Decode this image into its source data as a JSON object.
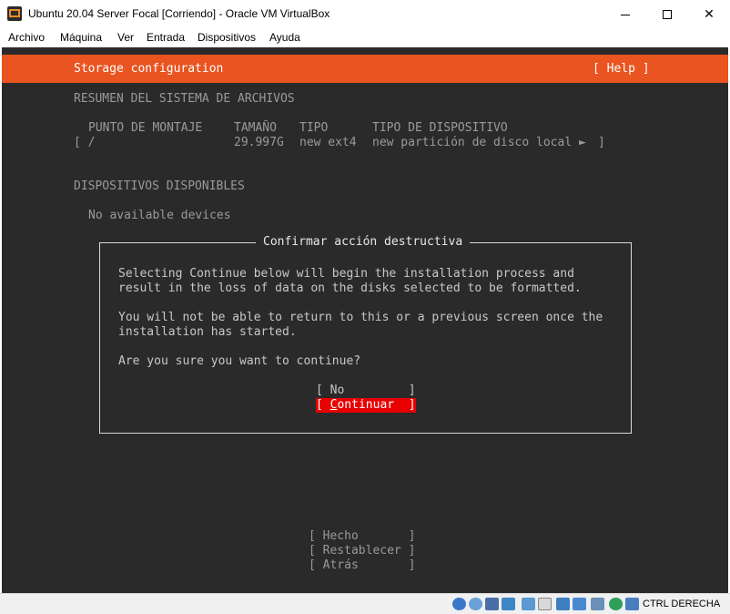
{
  "window": {
    "title": "Ubuntu 20.04 Server Focal [Corriendo] - Oracle VM VirtualBox",
    "minimize": "—",
    "maximize": "☐",
    "close": "✕"
  },
  "menu": [
    "Archivo",
    "Máquina",
    "Ver",
    "Entrada",
    "Dispositivos",
    "Ayuda"
  ],
  "console": {
    "header": {
      "title": "Storage configuration",
      "help": "[ Help ]",
      "color": "#e95420"
    },
    "summary_title": "RESUMEN DEL SISTEMA DE ARCHIVOS",
    "columns": {
      "mount": "PUNTO DE MONTAJE",
      "size": "TAMAÑO",
      "type": "TIPO",
      "device_type": "TIPO DE DISPOSITIVO"
    },
    "row": {
      "prefix": "[ /",
      "size": "29.997G",
      "type": "new ext4",
      "device_type": "new partición de disco local ►",
      "suffix": "]"
    },
    "available_title": "DISPOSITIVOS DISPONIBLES",
    "no_devices": "No available devices",
    "dialog": {
      "title": "Confirmar acción destructiva",
      "line1": "Selecting Continue below will begin the installation process and",
      "line2": "result in the loss of data on the disks selected to be formatted.",
      "line3": "You will not be able to return to this or a previous screen once the",
      "line4": "installation has started.",
      "line5": "Are you sure you want to continue?",
      "no_button": "[ No         ]",
      "continue_open": "[ ",
      "continue_cursor": "C",
      "continue_rest": "ontinuar  ]",
      "highlight_color": "#e80000"
    },
    "bottom_buttons": {
      "done": "[ Hecho       ]",
      "reset": "[ Restablecer ]",
      "back": "[ Atrás       ]"
    }
  },
  "statusbar": {
    "host_key": "CTRL DERECHA",
    "icons": [
      "hard-disk-icon",
      "optical-drive-icon",
      "audio-icon",
      "network-icon",
      "usb-icon",
      "shared-folders-icon",
      "display-icon",
      "video-capture-icon",
      "mouse-integration-icon",
      "cpu-icon",
      "recording-icon",
      "keyboard-icon"
    ]
  }
}
